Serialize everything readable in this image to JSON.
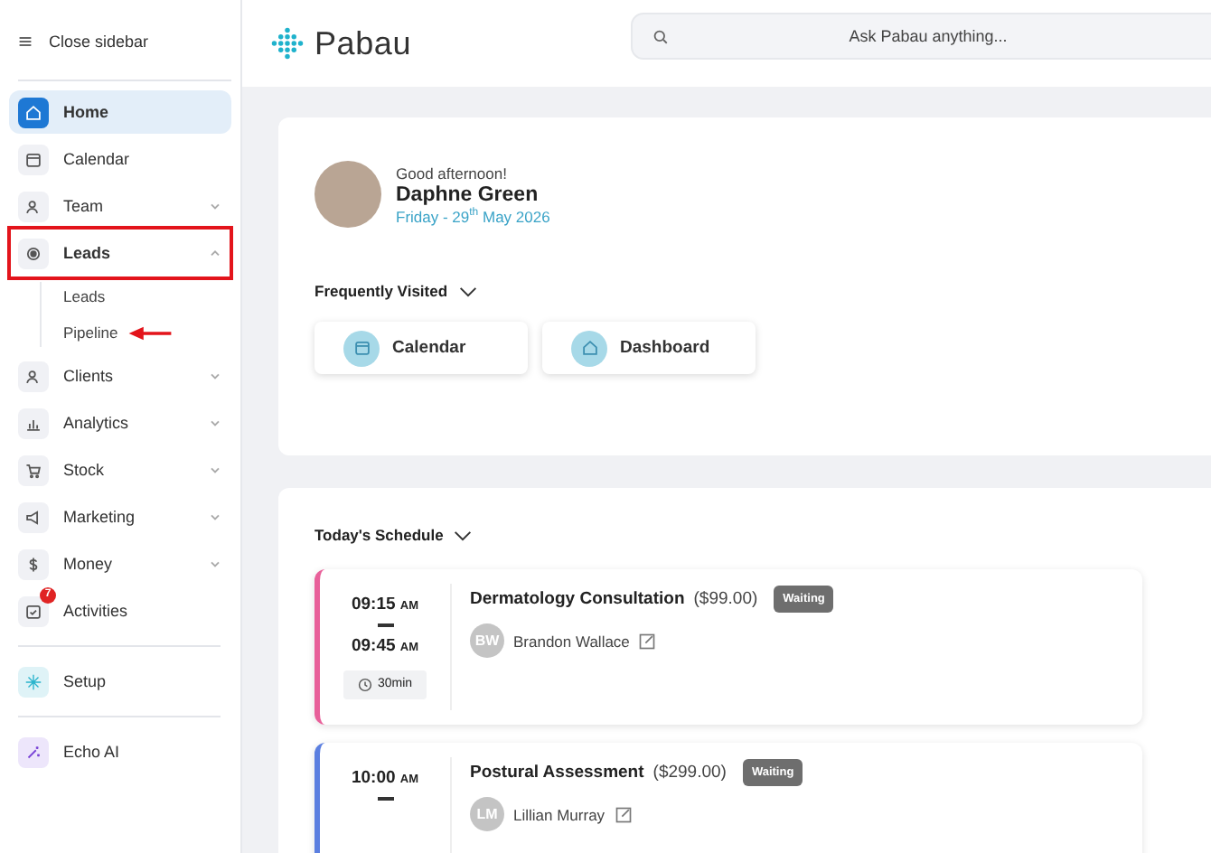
{
  "sidebar": {
    "toggle_label": "Close sidebar",
    "items": [
      {
        "label": "Home",
        "selected": true
      },
      {
        "label": "Calendar",
        "selected": false
      },
      {
        "label": "Team",
        "selected": false,
        "expanded": false
      },
      {
        "label": "Leads",
        "selected": false,
        "expanded": true,
        "annotated": true,
        "children": [
          {
            "label": "Leads",
            "annotated": false
          },
          {
            "label": "Pipeline",
            "annotated": true
          }
        ]
      },
      {
        "label": "Clients",
        "selected": false,
        "expanded": false
      },
      {
        "label": "Analytics",
        "selected": false,
        "expanded": false
      },
      {
        "label": "Stock",
        "selected": false,
        "expanded": false
      },
      {
        "label": "Marketing",
        "selected": false,
        "expanded": false
      },
      {
        "label": "Money",
        "selected": false,
        "expanded": false
      },
      {
        "label": "Activities",
        "selected": false,
        "badge": "7"
      }
    ],
    "bottom_items": [
      {
        "label": "Setup"
      },
      {
        "label": "Echo AI"
      }
    ]
  },
  "header": {
    "logo": "Pabau",
    "search": {
      "placeholder": "Ask Pabau anything..."
    }
  },
  "welcome": {
    "greeting": "Good afternoon!",
    "name": "Daphne Green",
    "date": "Friday - 29$^{th}$ May 2026"
  },
  "frequently_visited": {
    "title": "Frequently Visited",
    "items": [
      {
        "label": "Calendar"
      },
      {
        "label": "Dashboard"
      }
    ]
  },
  "schedule": {
    "title": "Today's Schedule",
    "appointments": [
      {
        "start": "09:15",
        "start_period": "AM",
        "end": "09:45",
        "end_period": "AM",
        "duration": "30min",
        "title": "Dermatology Consultation",
        "price": "($99.00)",
        "status": "Waiting",
        "client_initials": "BW",
        "client": "Brandon Wallace",
        "color": "#e8609a"
      },
      {
        "start": "10:00",
        "start_period": "AM",
        "title": "Postural Assessment",
        "price": "($299.00)",
        "status": "Waiting",
        "client_initials": "LM",
        "client": "Lillian Murray",
        "color": "#5b7fe0"
      }
    ]
  }
}
